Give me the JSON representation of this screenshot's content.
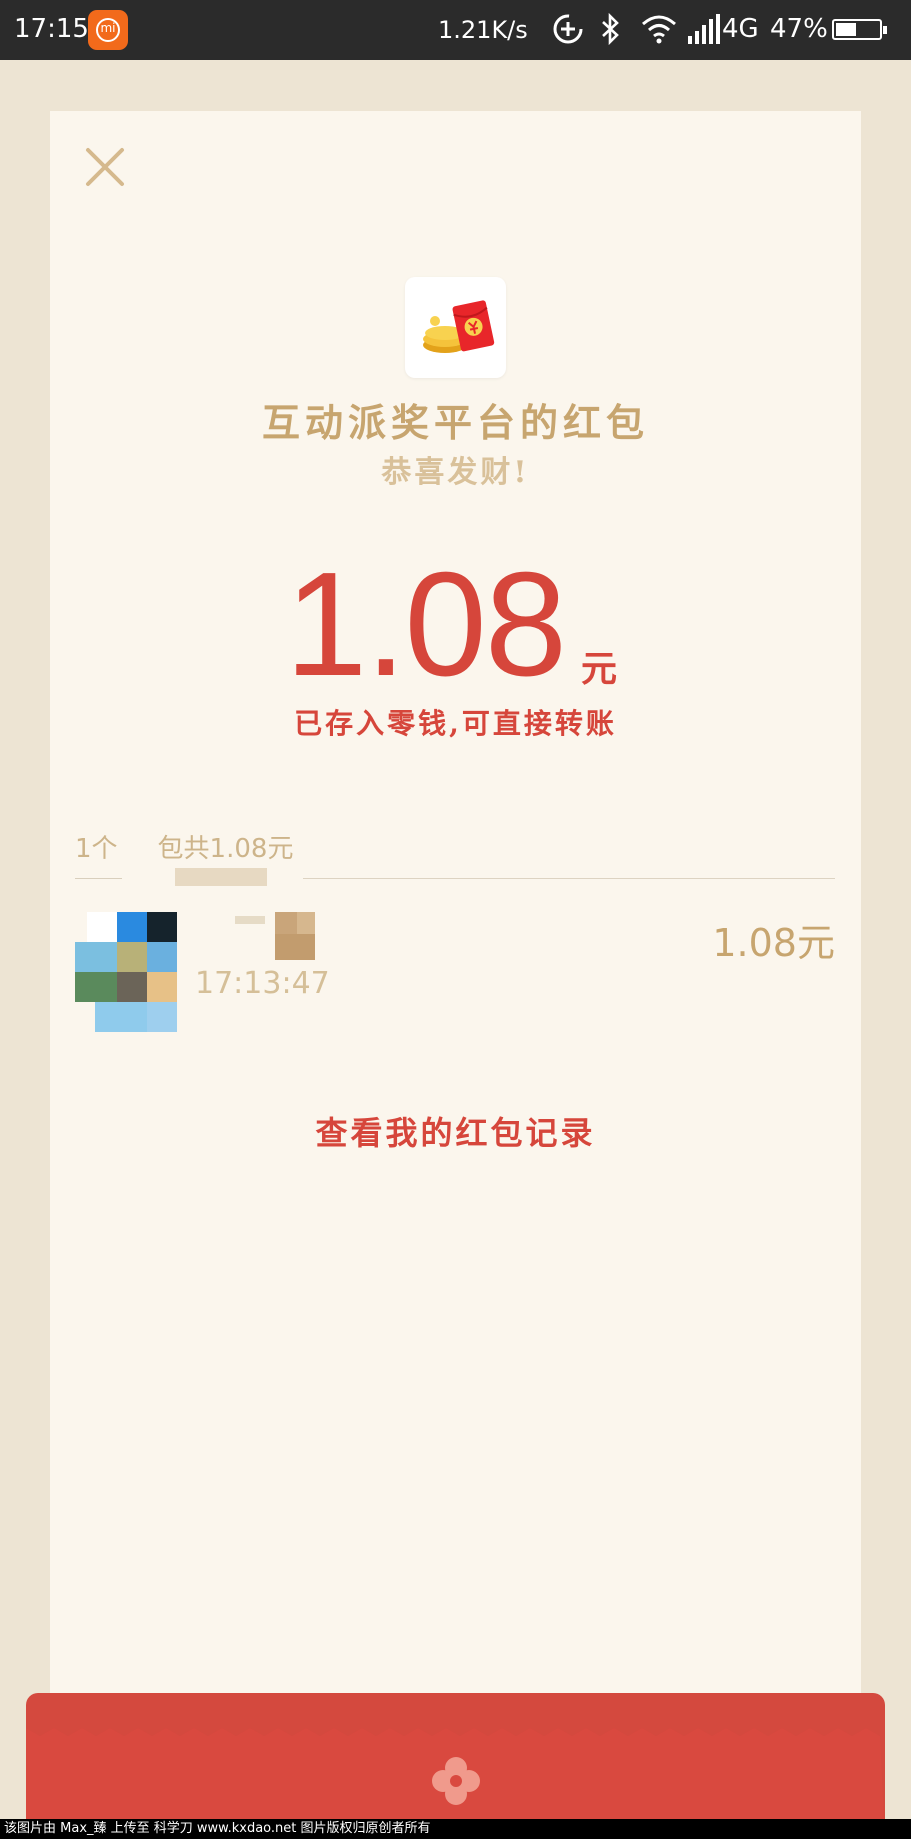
{
  "status_bar": {
    "time": "17:15",
    "app_badge_text": "mi",
    "net_speed": "1.21K/s",
    "network": "4G",
    "battery_pct": "47%",
    "battery_level": 0.47,
    "icons": [
      "sync-icon",
      "bluetooth-icon",
      "wifi-icon",
      "signal-icon",
      "battery-icon"
    ]
  },
  "card": {
    "close_icon": "close-icon",
    "app_icon": "red-envelope-logo",
    "title": "互动派奖平台的红包",
    "subtitle": "恭喜发财!",
    "amount": "1.08",
    "unit": "元",
    "saved_note": "已存入零钱,可直接转账",
    "summary_left": "1个",
    "summary_right": "包共1.08元",
    "records": [
      {
        "time": "17:13:47",
        "amount": "1.08元"
      }
    ],
    "records_link": "查看我的红包记录"
  },
  "watermark": "该图片由 Max_臻 上传至 科学刀 www.kxdao.net 图片版权归原创者所有",
  "colors": {
    "accent_red": "#d6463b",
    "gold": "#c7a56f",
    "card_bg": "#fbf6ed",
    "page_bg": "#ede4d3"
  }
}
